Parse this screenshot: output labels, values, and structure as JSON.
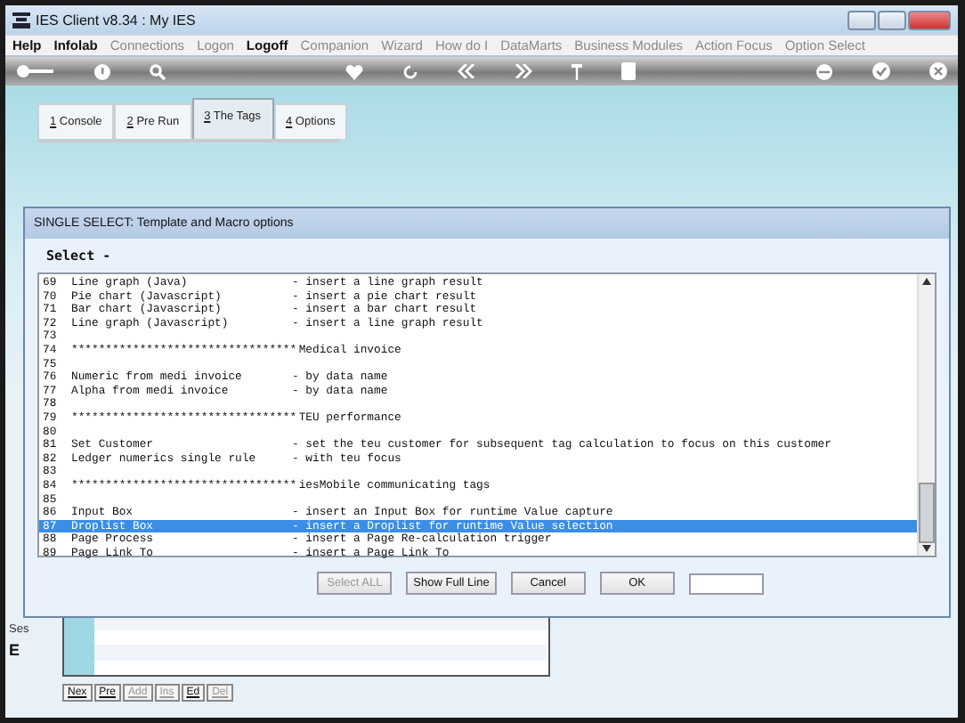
{
  "window": {
    "title": "IES Client v8.34 : My IES"
  },
  "menu": [
    {
      "label": "Help",
      "enabled": true
    },
    {
      "label": "Infolab",
      "enabled": true
    },
    {
      "label": "Connections",
      "enabled": false
    },
    {
      "label": "Logon",
      "enabled": false
    },
    {
      "label": "Logoff",
      "enabled": true
    },
    {
      "label": "Companion",
      "enabled": false
    },
    {
      "label": "Wizard",
      "enabled": false
    },
    {
      "label": "How do I",
      "enabled": false
    },
    {
      "label": "DataMarts",
      "enabled": false
    },
    {
      "label": "Business Modules",
      "enabled": false
    },
    {
      "label": "Action Focus",
      "enabled": false
    },
    {
      "label": "Option Select",
      "enabled": false
    }
  ],
  "tabs": [
    {
      "key": "1",
      "label": "Console",
      "selected": false
    },
    {
      "key": "2",
      "label": "Pre Run",
      "selected": false
    },
    {
      "key": "3",
      "label": "The Tags",
      "selected": true
    },
    {
      "key": "4",
      "label": "Options",
      "selected": false
    }
  ],
  "dialog": {
    "title": "SINGLE SELECT: Template and Macro options",
    "heading": "Select -",
    "rows": [
      {
        "num": "69",
        "name": "Line graph (Java)",
        "desc": "- insert a line graph result",
        "selected": false
      },
      {
        "num": "70",
        "name": "Pie chart (Javascript)",
        "desc": "- insert a pie chart result",
        "selected": false
      },
      {
        "num": "71",
        "name": "Bar chart (Javascript)",
        "desc": "- insert a bar chart result",
        "selected": false
      },
      {
        "num": "72",
        "name": "Line graph (Javascript)",
        "desc": "- insert a line graph result",
        "selected": false
      },
      {
        "num": "73",
        "name": "",
        "desc": "",
        "selected": false
      },
      {
        "num": "74",
        "name": "*********************************",
        "desc": " Medical invoice",
        "selected": false
      },
      {
        "num": "75",
        "name": "",
        "desc": "",
        "selected": false
      },
      {
        "num": "76",
        "name": "Numeric from medi invoice",
        "desc": "- by data name",
        "selected": false
      },
      {
        "num": "77",
        "name": "Alpha from medi invoice",
        "desc": "- by data name",
        "selected": false
      },
      {
        "num": "78",
        "name": "",
        "desc": "",
        "selected": false
      },
      {
        "num": "79",
        "name": "*********************************",
        "desc": " TEU performance",
        "selected": false
      },
      {
        "num": "80",
        "name": "",
        "desc": "",
        "selected": false
      },
      {
        "num": "81",
        "name": "Set Customer",
        "desc": "- set the teu customer for subsequent tag calculation to focus on this customer",
        "selected": false
      },
      {
        "num": "82",
        "name": "Ledger numerics single rule",
        "desc": "- with teu focus",
        "selected": false
      },
      {
        "num": "83",
        "name": "",
        "desc": "",
        "selected": false
      },
      {
        "num": "84",
        "name": "*********************************",
        "desc": " iesMobile communicating tags",
        "selected": false
      },
      {
        "num": "85",
        "name": "",
        "desc": "",
        "selected": false
      },
      {
        "num": "86",
        "name": "Input Box",
        "desc": "- insert an Input Box for runtime Value capture",
        "selected": false
      },
      {
        "num": "87",
        "name": "Droplist Box",
        "desc": "- insert a Droplist for runtime Value selection",
        "selected": true
      },
      {
        "num": "88",
        "name": "Page Process",
        "desc": "- insert a Page Re-calculation trigger",
        "selected": false
      },
      {
        "num": "89",
        "name": "Page Link To",
        "desc": "- insert a Page Link To",
        "selected": false
      }
    ],
    "buttons": [
      {
        "label": "Select ALL",
        "enabled": false
      },
      {
        "label": "Show Full Line",
        "enabled": true
      },
      {
        "label": "Cancel",
        "enabled": true
      },
      {
        "label": "OK",
        "enabled": true
      }
    ]
  },
  "side_labels": [
    "Ses",
    "E"
  ],
  "nav_buttons": [
    {
      "label": "Nex",
      "enabled": true
    },
    {
      "label": "Pre",
      "enabled": true
    },
    {
      "label": "Add",
      "enabled": false
    },
    {
      "label": "Ins",
      "enabled": false
    },
    {
      "label": "Ed",
      "enabled": true
    },
    {
      "label": "Del",
      "enabled": false
    }
  ]
}
